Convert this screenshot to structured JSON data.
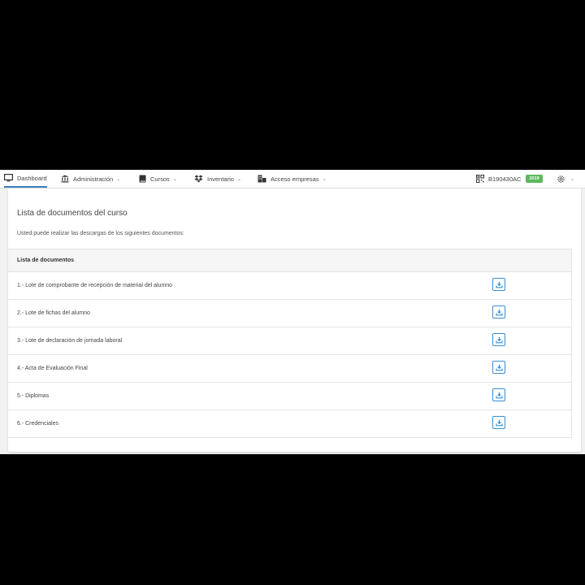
{
  "nav": {
    "items": [
      {
        "label": "Dashboard",
        "icon": "monitor-icon",
        "dropdown": false
      },
      {
        "label": "Administración",
        "icon": "bank-icon",
        "dropdown": true
      },
      {
        "label": "Cursos",
        "icon": "book-icon",
        "dropdown": true
      },
      {
        "label": "Inventario",
        "icon": "dropbox-icon",
        "dropdown": true
      },
      {
        "label": "Acceso empresas",
        "icon": "building-icon",
        "dropdown": true
      }
    ],
    "user": {
      "code": "B190430AC",
      "year_badge": "2019",
      "icon": "qr-code-icon"
    },
    "settings_icon": "gear-icon",
    "accent": "#3a7fc1",
    "badge_color": "#5cb85c"
  },
  "card": {
    "title": "Lista de documentos del curso",
    "description": "Usted puede realizar las descargas de los siguientes documentos:",
    "table_header": "Lista de documentos",
    "documents": [
      "1.- Lote de comprobante de recepción de material del alumno",
      "2.- Lote de fichas del alumno",
      "3.- Lote de declaración de jornada laboral",
      "4.- Acta de Evaluación Final",
      "5.- Diplomas",
      "6.- Credenciales"
    ],
    "download_icon": "download-icon",
    "download_color": "#3a8fd0"
  }
}
